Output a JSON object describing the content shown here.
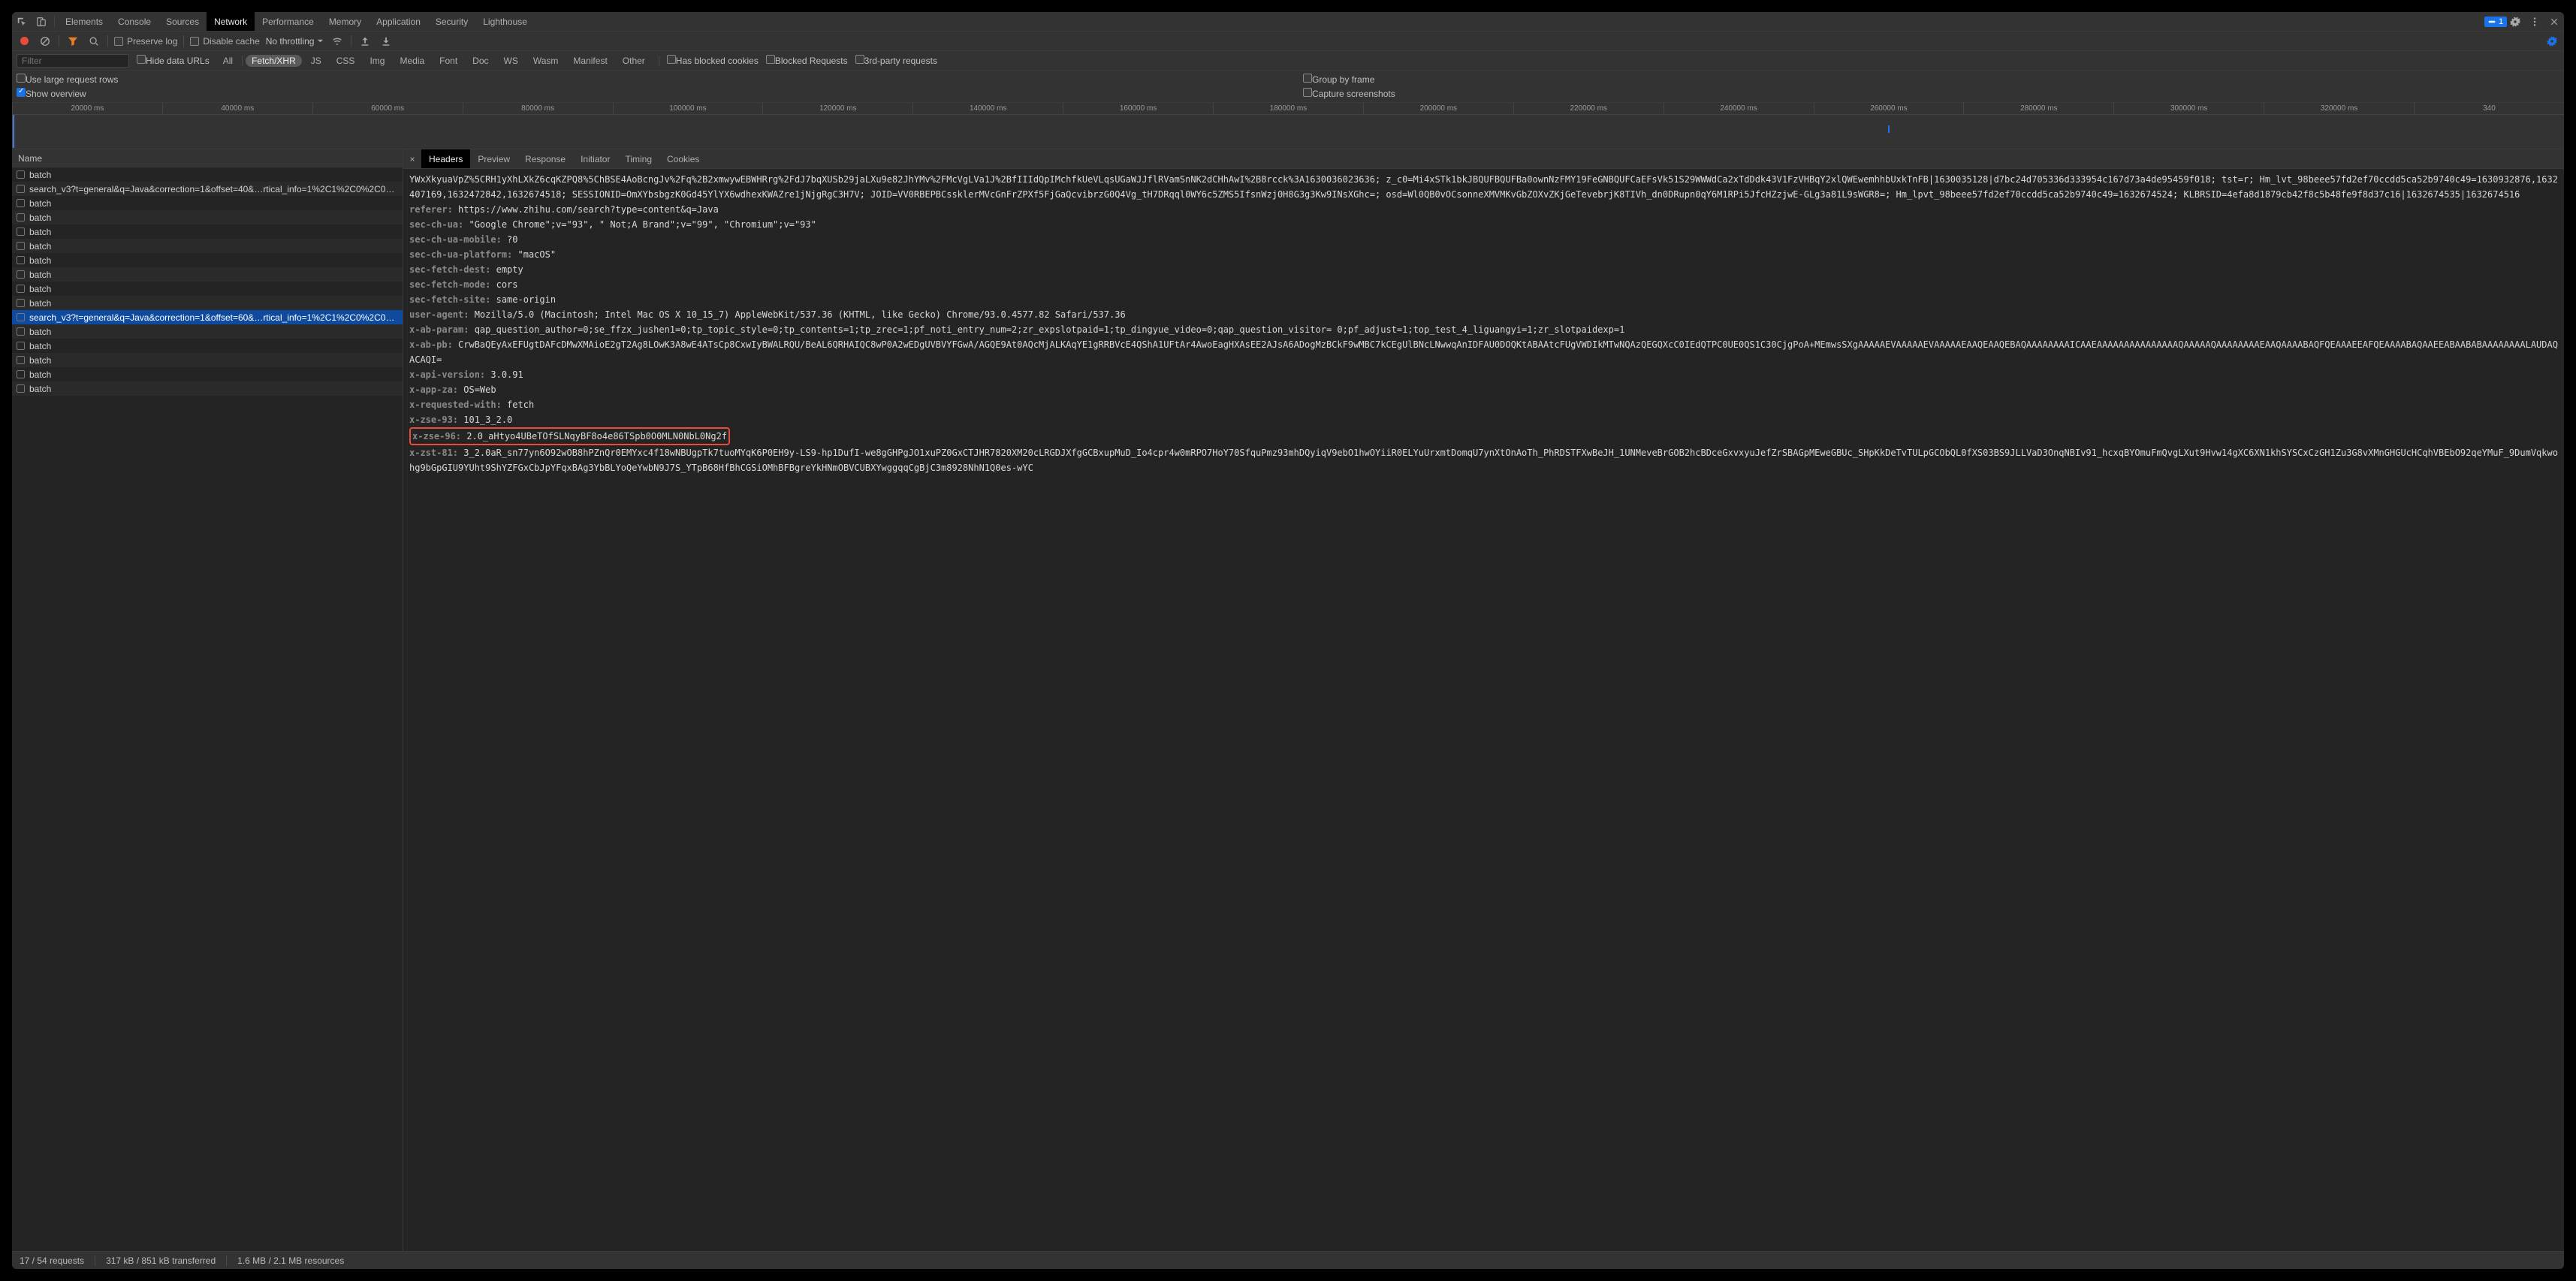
{
  "topTabs": {
    "items": [
      {
        "label": "Elements"
      },
      {
        "label": "Console"
      },
      {
        "label": "Sources"
      },
      {
        "label": "Network"
      },
      {
        "label": "Performance"
      },
      {
        "label": "Memory"
      },
      {
        "label": "Application"
      },
      {
        "label": "Security"
      },
      {
        "label": "Lighthouse"
      }
    ],
    "activeIndex": 3,
    "issuesBadge": "1"
  },
  "toolbar": {
    "preserveLog": "Preserve log",
    "disableCache": "Disable cache",
    "throttling": "No throttling"
  },
  "filter": {
    "placeholder": "Filter",
    "hideDataUrls": "Hide data URLs",
    "types": [
      "All",
      "Fetch/XHR",
      "JS",
      "CSS",
      "Img",
      "Media",
      "Font",
      "Doc",
      "WS",
      "Wasm",
      "Manifest",
      "Other"
    ],
    "activeType": 1,
    "hasBlockedCookies": "Has blocked cookies",
    "blockedRequests": "Blocked Requests",
    "thirdParty": "3rd-party requests"
  },
  "options": {
    "useLarge": "Use large request rows",
    "showOverview": "Show overview",
    "groupByFrame": "Group by frame",
    "captureScreens": "Capture screenshots"
  },
  "timeline": {
    "ticks": [
      "20000 ms",
      "40000 ms",
      "60000 ms",
      "80000 ms",
      "100000 ms",
      "120000 ms",
      "140000 ms",
      "160000 ms",
      "180000 ms",
      "200000 ms",
      "220000 ms",
      "240000 ms",
      "260000 ms",
      "280000 ms",
      "300000 ms",
      "320000 ms",
      "340"
    ]
  },
  "requestsPanel": {
    "header": "Name",
    "rows": [
      {
        "name": "batch"
      },
      {
        "name": "search_v3?t=general&q=Java&correction=1&offset=40&…rtical_info=1%2C1%2C0%2C0%2C…"
      },
      {
        "name": "batch"
      },
      {
        "name": "batch"
      },
      {
        "name": "batch"
      },
      {
        "name": "batch"
      },
      {
        "name": "batch"
      },
      {
        "name": "batch"
      },
      {
        "name": "batch"
      },
      {
        "name": "batch"
      },
      {
        "name": "search_v3?t=general&q=Java&correction=1&offset=60&…rtical_info=1%2C1%2C0%2C0%2C…"
      },
      {
        "name": "batch"
      },
      {
        "name": "batch"
      },
      {
        "name": "batch"
      },
      {
        "name": "batch"
      },
      {
        "name": "batch"
      }
    ],
    "selectedIndex": 10
  },
  "detailTabs": {
    "items": [
      "Headers",
      "Preview",
      "Response",
      "Initiator",
      "Timing",
      "Cookies"
    ],
    "activeIndex": 0
  },
  "headers": {
    "preamble": "YWxXkyuaVpZ%5CRH1yXhLXkZ6cqKZPQ8%5ChBSE4AoBcngJv%2Fq%2B2xmwywEBWHRrg%2FdJ7bqXUSb29jaLXu9e82JhYMv%2FMcVgLVa1J%2BfIIIdQpIMchfkUeVLqsUGaWJJflRVamSnNK2dCHhAwI%2B8rcck%3A1630036023636; z_c0=Mi4xSTk1bkJBQUFBQUFBa0ownNzFMY19FeGNBQUFCaEFsVk51S29WWWdCa2xTdDdk43V1FzVHBqY2xlQWEwemhhbUxkTnFB|1630035128|d7bc24d705336d333954c167d73a4de95459f018; tst=r; Hm_lvt_98beee57fd2ef70ccdd5ca52b9740c49=1630932876,1632407169,1632472842,1632674518; SESSIONID=OmXYbsbgzK0Gd45YlYX6wdhexKWAZre1jNjgRgC3H7V; JOID=VV0RBEPBCssklerMVcGnFrZPXf5FjGaQcvibrzG0Q4Vg_tH7DRqql0WY6c5ZMS5IfsnWzj0H8G3g3Kw9INsXGhc=; osd=Wl0QB0vOCsonneXMVMKvGbZOXvZKjGeTevebrjK8TIVh_dn0DRupn0qY6M1RPi5JfcHZzjwE-GLg3a81L9sWGR8=; Hm_lpvt_98beee57fd2ef70ccdd5ca52b9740c49=1632674524; KLBRSID=4efa8d1879cb42f8c5b48fe9f8d37c16|1632674535|1632674516",
    "items": [
      {
        "k": "referer",
        "v": "https://www.zhihu.com/search?type=content&q=Java"
      },
      {
        "k": "sec-ch-ua",
        "v": "\"Google Chrome\";v=\"93\", \" Not;A Brand\";v=\"99\", \"Chromium\";v=\"93\""
      },
      {
        "k": "sec-ch-ua-mobile",
        "v": "?0"
      },
      {
        "k": "sec-ch-ua-platform",
        "v": "\"macOS\""
      },
      {
        "k": "sec-fetch-dest",
        "v": "empty"
      },
      {
        "k": "sec-fetch-mode",
        "v": "cors"
      },
      {
        "k": "sec-fetch-site",
        "v": "same-origin"
      },
      {
        "k": "user-agent",
        "v": "Mozilla/5.0 (Macintosh; Intel Mac OS X 10_15_7) AppleWebKit/537.36 (KHTML, like Gecko) Chrome/93.0.4577.82 Safari/537.36"
      },
      {
        "k": "x-ab-param",
        "v": "qap_question_author=0;se_ffzx_jushen1=0;tp_topic_style=0;tp_contents=1;tp_zrec=1;pf_noti_entry_num=2;zr_expslotpaid=1;tp_dingyue_video=0;qap_question_visitor= 0;pf_adjust=1;top_test_4_liguangyi=1;zr_slotpaidexp=1"
      },
      {
        "k": "x-ab-pb",
        "v": "CrwBaQEyAxEFUgtDAFcDMwXMAioE2gT2Ag8LOwK3A8wE4ATsCp8CxwIyBWALRQU/BeAL6QRHAIQC8wP0A2wEDgUVBVYFGwA/AGQE9At0AQcMjALKAqYE1gRRBVcE4QShA1UFtAr4AwoEagHXAsEE2AJsA6ADogMzBCkF9wMBC7kCEgUlBNcLNwwqAnIDFAU0DOQKtABAAtcFUgVWDIkMTwNQAzQEGQXcC0IEdQTPC0UE0QS1C30CjgPoA+MEmwsSXgAAAAAEVAAAAAEVAAAAAEAAQEAAQEBAQAAAAAAAAICAAEAAAAAAAAAAAAAAAQAAAAAQAAAAAAAAEAAQAAAABAQFQEAAAEEAFQEAAAABAQAAEEABAABABAAAAAAAALAUDAQACAQI="
      },
      {
        "k": "x-api-version",
        "v": "3.0.91"
      },
      {
        "k": "x-app-za",
        "v": "OS=Web"
      },
      {
        "k": "x-requested-with",
        "v": "fetch"
      },
      {
        "k": "x-zse-93",
        "v": "101_3_2.0"
      },
      {
        "k": "x-zse-96",
        "v": "2.0_aHtyo4UBeTOfSLNqyBF8o4e86TSpb0O0MLN0NbL0Ng2f",
        "hl": true
      },
      {
        "k": "x-zst-81",
        "v": "3_2.0aR_sn77yn6O92wOB8hPZnQr0EMYxc4f18wNBUgpTk7tuoMYqK6P0EH9y-LS9-hp1DufI-we8gGHPgJO1xuPZ0GxCTJHR7820XM20cLRGDJXfgGCBxupMuD_Io4cpr4w0mRPO7HoY70SfquPmz93mhDQyiqV9ebO1hwOYiiR0ELYuUrxmtDomqU7ynXtOnAoTh_PhRDSTFXwBeJH_1UNMeveBrGOB2hcBDceGxvxyuJefZrSBAGpMEweGBUc_SHpKkDeTvTULpGCObQL0fXS03BS9JLLVaD3OnqNBIv91_hcxqBYOmuFmQvgLXut9Hvw14gXC6XN1khSYSCxCzGH1Zu3G8vXMnGHGUcHCqhVBEbO92qeYMuF_9DumVqkwohg9bGpGIU9YUht9ShYZFGxCbJpYFqxBAg3YbBLYoQeYwbN9J7S_YTpB68HfBhCGSiOMhBFBgreYkHNmOBVCUBXYwggqqCgBjC3m8928NhN1Q0es-wYC"
      }
    ]
  },
  "status": {
    "requests": "17 / 54 requests",
    "transferred": "317 kB / 851 kB transferred",
    "resources": "1.6 MB / 2.1 MB resources"
  }
}
